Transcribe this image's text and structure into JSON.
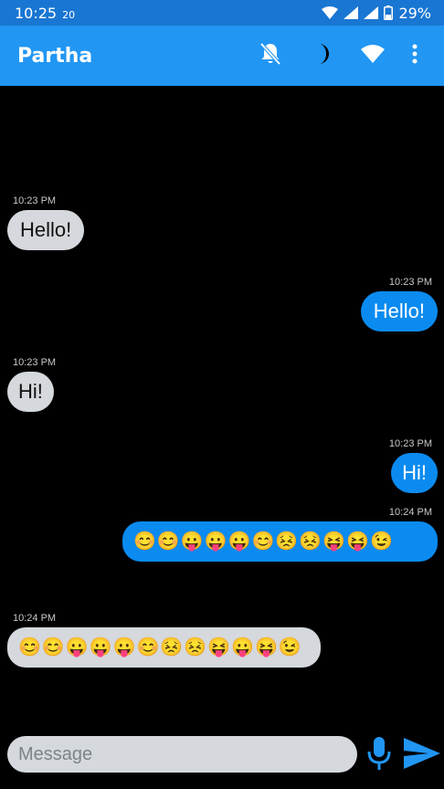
{
  "status_bar": {
    "time": "10:25",
    "time_extra": "20",
    "battery": "29%"
  },
  "app_bar": {
    "title": "Partha",
    "icons": [
      "bell-off-icon",
      "moon-icon",
      "wifi-icon",
      "more-vert-icon"
    ]
  },
  "messages": [
    {
      "direction": "incoming",
      "time": "10:23 PM",
      "text": "Hello!"
    },
    {
      "direction": "outgoing",
      "time": "10:23 PM",
      "text": "Hello!"
    },
    {
      "direction": "incoming",
      "time": "10:23 PM",
      "text": "Hi!"
    },
    {
      "direction": "outgoing",
      "time": "10:23 PM",
      "text": "Hi!"
    },
    {
      "direction": "outgoing",
      "time": "10:24 PM",
      "text": "😊😊😛😛😛😊😣😣😝😝😉"
    },
    {
      "direction": "incoming",
      "time": "10:24 PM",
      "text": "😊😊😛😛😛😊😣😣😝😛😝😉"
    }
  ],
  "input": {
    "placeholder": "Message"
  },
  "colors": {
    "status_bar": "#1976d2",
    "app_bar": "#2196f3",
    "incoming_bubble": "#d5d8dc",
    "outgoing_bubble": "#0b8bf0",
    "background": "#000000"
  }
}
